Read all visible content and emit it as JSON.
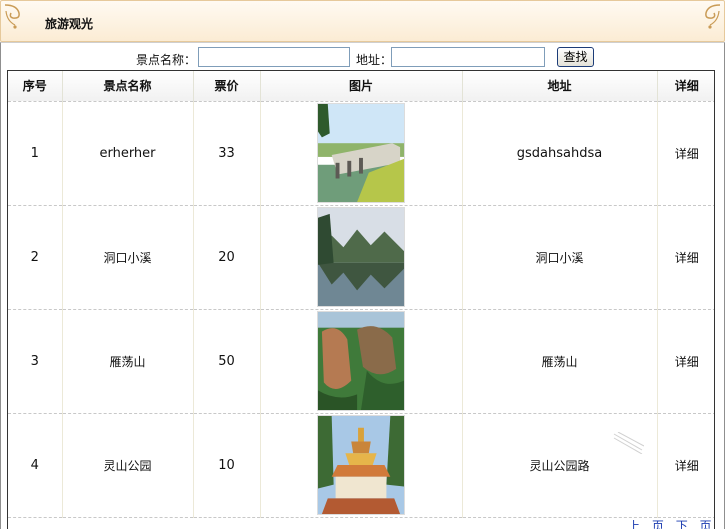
{
  "header": {
    "title": "旅游观光"
  },
  "search": {
    "name_label": "景点名称：",
    "name_value": "",
    "address_label": "地址：",
    "address_value": "",
    "button_label": "查找"
  },
  "table": {
    "columns": [
      "序号",
      "景点名称",
      "票价",
      "图片",
      "地址",
      "详细"
    ],
    "rows": [
      {
        "index": "1",
        "name": "erherher",
        "price": "33",
        "address": "gsdahsahdsa",
        "detail": "详细",
        "image": "stone-bridge-lake-photo"
      },
      {
        "index": "2",
        "name": "洞口小溪",
        "price": "20",
        "address": "洞口小溪",
        "detail": "详细",
        "image": "mountain-lake-reflection-photo"
      },
      {
        "index": "3",
        "name": "雁荡山",
        "price": "50",
        "address": "雁荡山",
        "detail": "详细",
        "image": "green-cliff-valley-photo"
      },
      {
        "index": "4",
        "name": "灵山公园",
        "price": "10",
        "address": "灵山公园路",
        "detail": "详细",
        "image": "golden-pagoda-temple-photo"
      }
    ]
  },
  "pager": {
    "labels": [
      "上",
      "页",
      "下",
      "页"
    ]
  },
  "colors": {
    "header_bg": "#fbecd4",
    "header_border": "#e6c99b",
    "button_border": "#1c3c78",
    "pager_link": "#1a3bb0"
  }
}
